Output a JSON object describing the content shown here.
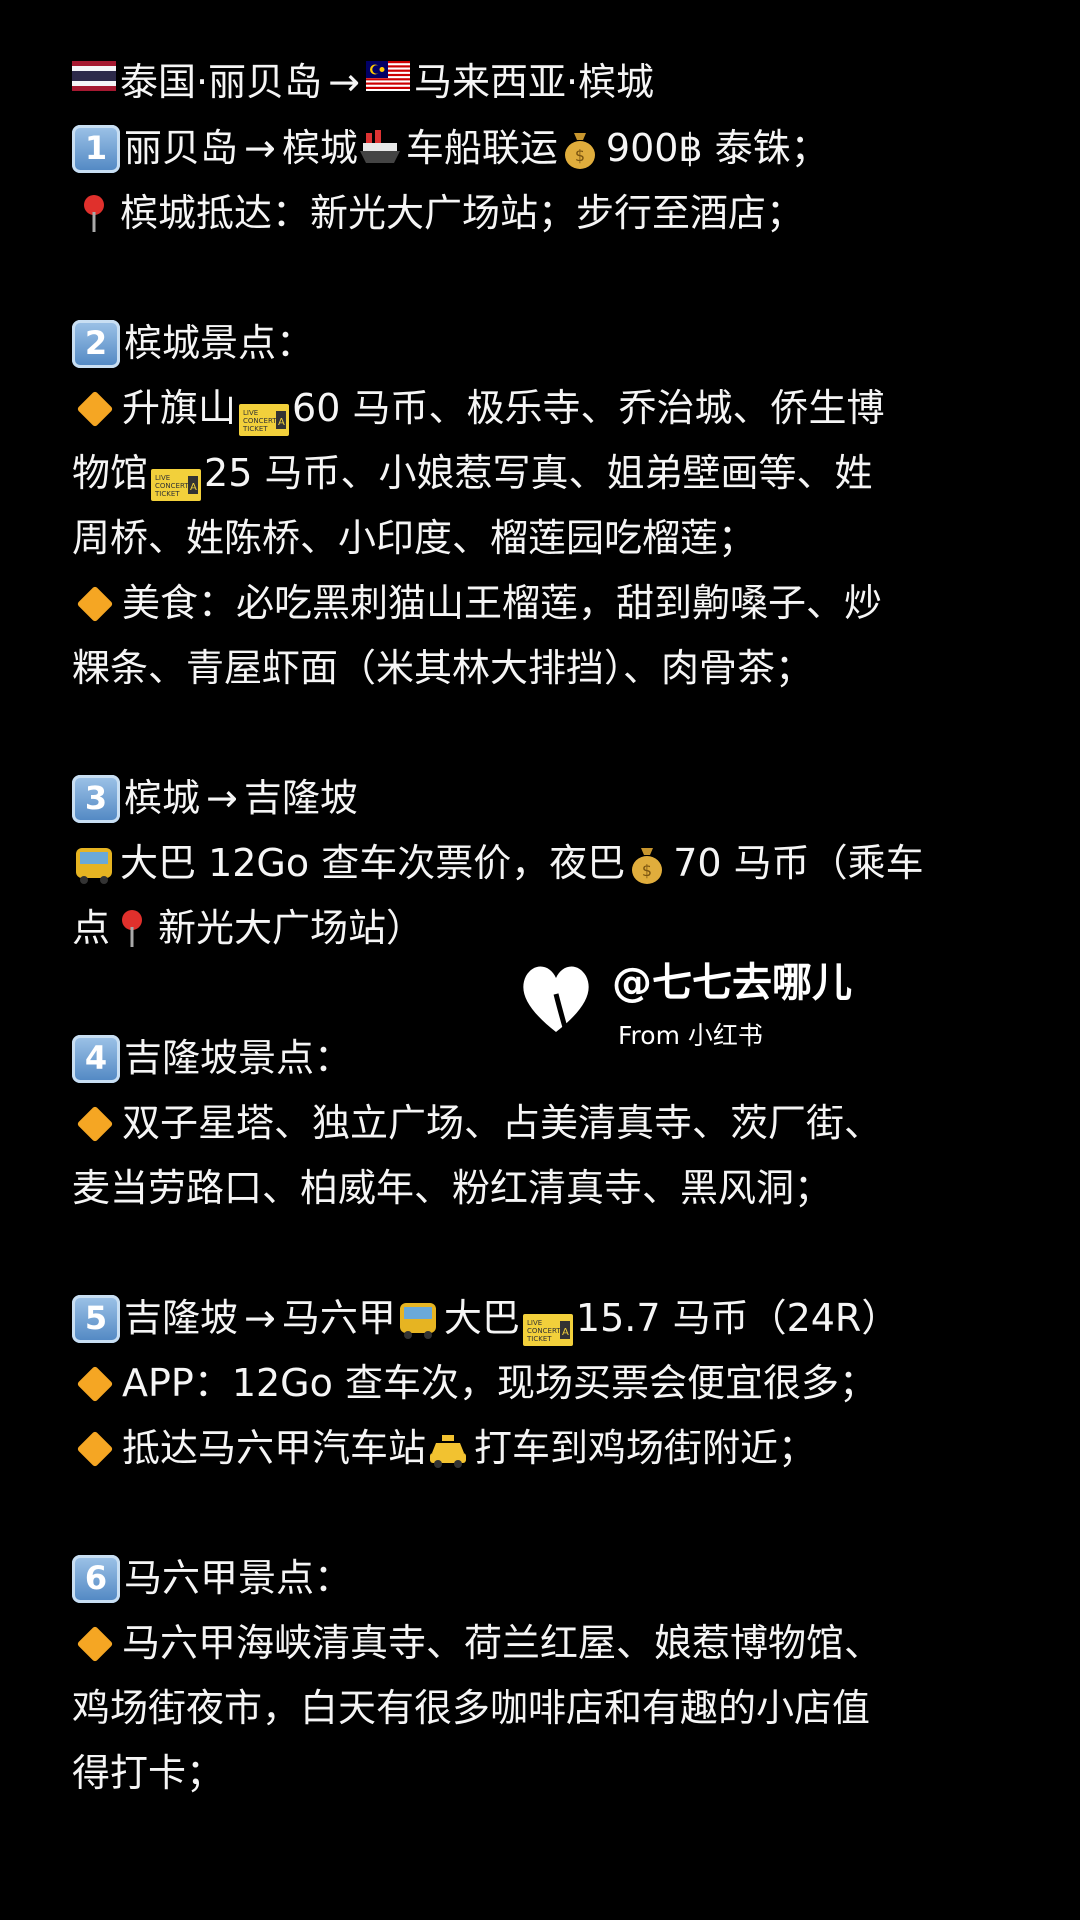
{
  "post": {
    "header": {
      "flag_left": "thailand-flag",
      "from_text": "泰国·丽贝岛",
      "arrow": "→",
      "flag_right": "malaysia-flag",
      "to_text": "马来西亚·槟城"
    },
    "s1": {
      "num": "1",
      "text_a": "丽贝岛",
      "arrow": "→",
      "text_b": "槟城",
      "text_c": "车船联运",
      "text_d": "900฿ 泰铢；",
      "line2": "槟城抵达：新光大广场站；步行至酒店；"
    },
    "s2": {
      "num": "2",
      "title": "槟城景点：",
      "l1_a": "升旗山",
      "l1_b": "60 马币、极乐寺、乔治城、侨生博",
      "l2_a": "物馆",
      "l2_b": "25 马币、小娘惹写真、姐弟壁画等、姓",
      "l3": "周桥、姓陈桥、小印度、榴莲园吃榴莲；",
      "l4": "美食：必吃黑刺猫山王榴莲，甜到齁嗓子、炒",
      "l5": "粿条、青屋虾面（米其林大排挡）、肉骨茶；"
    },
    "s3": {
      "num": "3",
      "text_a": "槟城",
      "arrow": "→",
      "text_b": "吉隆坡",
      "l1_a": "大巴 12Go 查车次票价，夜巴",
      "l1_b": "70 马币（乘车",
      "l2_a": "点",
      "l2_b": "新光大广场站）"
    },
    "s4": {
      "num": "4",
      "title": "吉隆坡景点：",
      "l1": "双子星塔、独立广场、占美清真寺、茨厂街、",
      "l2": "麦当劳路口、柏威年、粉红清真寺、黑风洞；"
    },
    "s5": {
      "num": "5",
      "text_a": "吉隆坡",
      "arrow": "→",
      "text_b": "马六甲",
      "text_c": "大巴",
      "text_d": " 15.7 马币（24R）",
      "l1": "APP：12Go 查车次，现场买票会便宜很多；",
      "l2_a": "抵达马六甲汽车站",
      "l2_b": "打车到鸡场街附近；"
    },
    "s6": {
      "num": "6",
      "title": "马六甲景点：",
      "l1": "马六甲海峡清真寺、荷兰红屋、娘惹博物馆、",
      "l2": "鸡场街夜市，白天有很多咖啡店和有趣的小店值",
      "l3": "得打卡；"
    }
  },
  "watermark": {
    "handle": "@七七去哪儿",
    "source": "From 小红书"
  },
  "colors": {
    "background": "#000000",
    "text": "#f5f5f5",
    "bullet": "#f5a623",
    "keycap": "#4f86c2"
  }
}
